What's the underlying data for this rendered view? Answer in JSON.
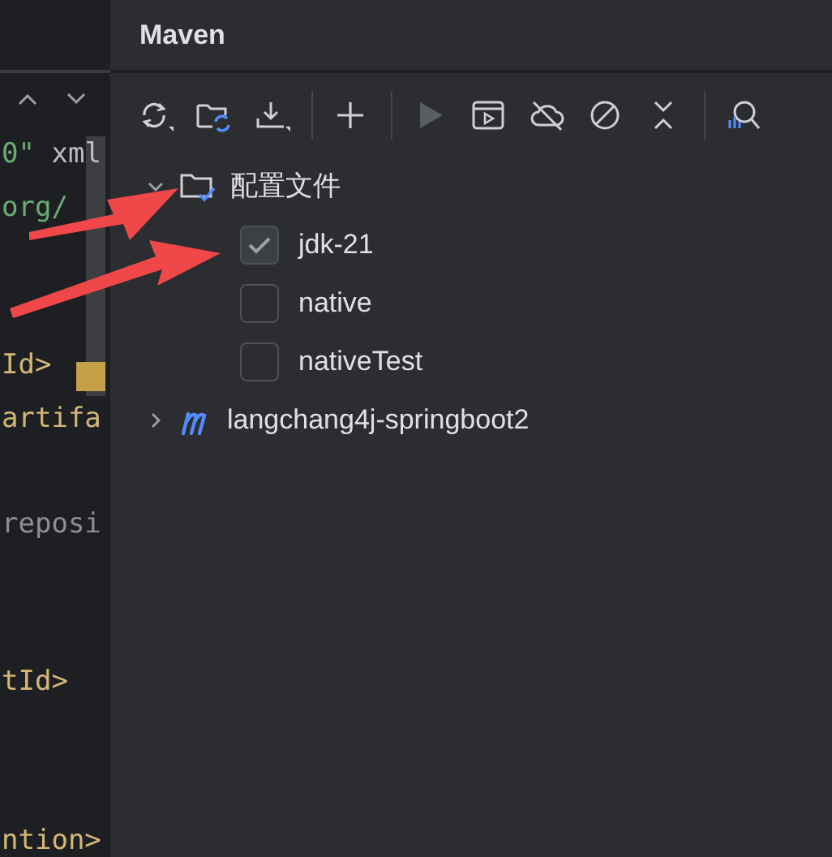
{
  "editor": {
    "lines": [
      {
        "segments": [
          {
            "text": "0\"",
            "kind": "string"
          },
          {
            "text": " xml",
            "kind": "attr"
          }
        ]
      },
      {
        "segments": [
          {
            "text": "org/",
            "kind": "string"
          }
        ]
      },
      {
        "segments": [
          {
            "text": "Id>",
            "kind": "tag"
          }
        ]
      },
      {
        "segments": [
          {
            "text": "artifa",
            "kind": "tag"
          }
        ]
      },
      {
        "segments": [
          {
            "text": "reposi",
            "kind": "plain"
          }
        ]
      },
      {
        "segments": [
          {
            "text": "tId>",
            "kind": "tag"
          }
        ]
      },
      {
        "segments": [
          {
            "text": "ntion>",
            "kind": "tag"
          }
        ]
      }
    ]
  },
  "panel": {
    "title": "Maven"
  },
  "toolbar": [
    {
      "kind": "sync"
    },
    {
      "kind": "folder-sync"
    },
    {
      "kind": "download"
    },
    {
      "kind": "separator"
    },
    {
      "kind": "add"
    },
    {
      "kind": "separator"
    },
    {
      "kind": "run",
      "disabled": true
    },
    {
      "kind": "run-window"
    },
    {
      "kind": "offline"
    },
    {
      "kind": "skip"
    },
    {
      "kind": "collapse"
    },
    {
      "kind": "separator"
    },
    {
      "kind": "analyze"
    }
  ],
  "tree": [
    {
      "kind": "profiles",
      "label": "配置文件",
      "expanded": true,
      "children": [
        {
          "label": "jdk-21",
          "checked": true
        },
        {
          "label": "native",
          "checked": false
        },
        {
          "label": "nativeTest",
          "checked": false
        }
      ]
    },
    {
      "kind": "project",
      "label": "langchang4j-springboot2",
      "expanded": false
    }
  ]
}
